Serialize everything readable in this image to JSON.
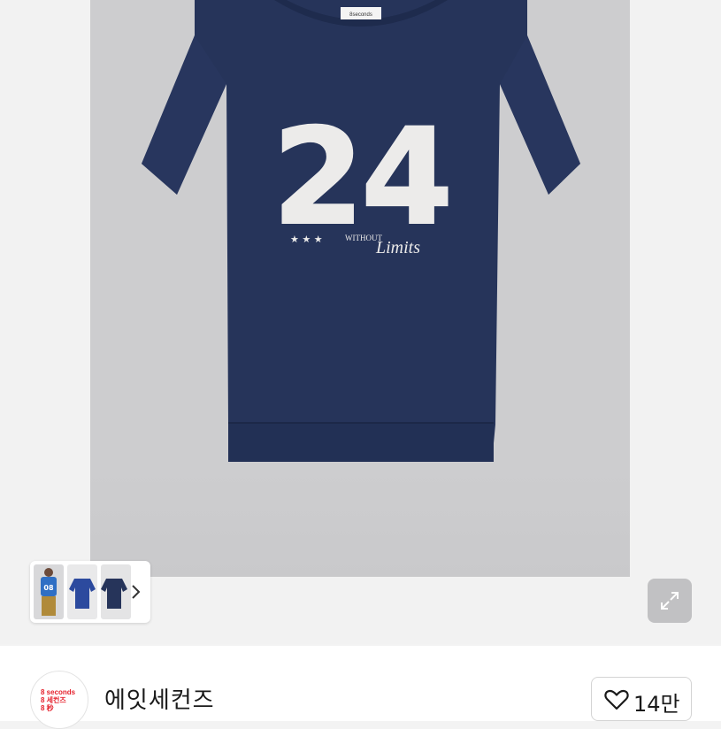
{
  "product": {
    "shirt_print_number": "24",
    "shirt_print_tagline_small": "WITHOUT",
    "shirt_print_tagline_script": "Limits",
    "shirt_label": "8seconds",
    "shirt_color": "#26345a",
    "gallery_bg": "#cdcdcf"
  },
  "thumbnails": {
    "items": [
      {
        "name": "model-wearing-blue-tee"
      },
      {
        "name": "blue-tee-front"
      },
      {
        "name": "navy-tee-front"
      }
    ],
    "thumb_number": "08"
  },
  "brand": {
    "logo_lines": [
      "8 seconds",
      "8 세컨즈",
      "8 秒"
    ],
    "logo_color": "#e5232e",
    "name": "에잇세컨즈"
  },
  "like": {
    "count": "14만"
  },
  "icons": {
    "chevron": "chevron-right-icon",
    "expand": "expand-icon",
    "heart": "heart-icon"
  }
}
